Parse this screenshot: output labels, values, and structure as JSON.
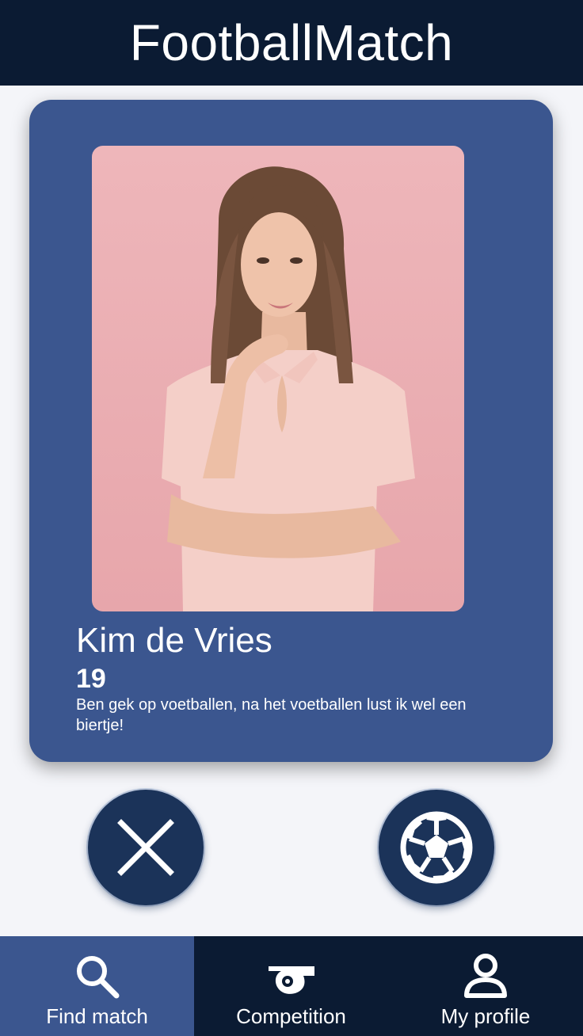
{
  "header": {
    "title": "FootballMatch"
  },
  "profile": {
    "name": "Kim de Vries",
    "age": "19",
    "bio": "Ben gek op voetballen, na het voetballen lust ik wel een biertje!",
    "photo": "portrait-photo"
  },
  "actions": {
    "reject": {
      "icon": "close-icon"
    },
    "like": {
      "icon": "football-icon"
    }
  },
  "nav": {
    "items": [
      {
        "label": "Find match",
        "icon": "search-icon",
        "active": true
      },
      {
        "label": "Competition",
        "icon": "whistle-icon",
        "active": false
      },
      {
        "label": "My profile",
        "icon": "user-icon",
        "active": false
      }
    ]
  },
  "colors": {
    "header_bg": "#0b1b33",
    "card_bg": "#3b568f",
    "button_bg": "#1b3359",
    "page_bg": "#f4f5f9",
    "photo_bg": "#eeb6ba"
  }
}
